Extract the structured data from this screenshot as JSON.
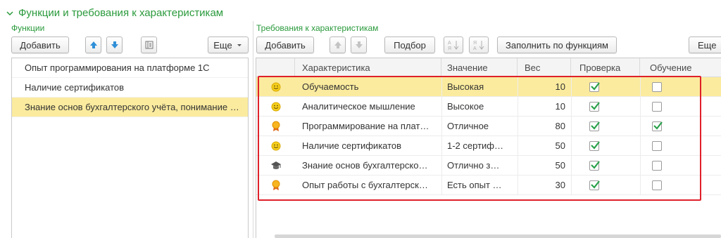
{
  "group": {
    "title": "Функции и требования к характеристикам"
  },
  "left": {
    "label": "Функции",
    "add_label": "Добавить",
    "more_label": "Еще",
    "items": [
      {
        "label": "Опыт программирования на платформе 1С"
      },
      {
        "label": "Наличие сертификатов"
      },
      {
        "label": "Знание основ бухгалтерского учёта, понимание …"
      }
    ]
  },
  "right": {
    "label": "Требования к характеристикам",
    "add_label": "Добавить",
    "select_label": "Подбор",
    "fill_label": "Заполнить по функциям",
    "more_label": "Еще",
    "columns": {
      "characteristic": "Характеристика",
      "value": "Значение",
      "weight": "Вес",
      "check": "Проверка",
      "training": "Обучение"
    },
    "rows": [
      {
        "icon": "smiley-icon",
        "characteristic": "Обучаемость",
        "value": "Высокая",
        "weight": "10",
        "check": true,
        "training": false
      },
      {
        "icon": "smiley-icon",
        "characteristic": "Аналитическое мышление",
        "value": "Высокое",
        "weight": "10",
        "check": true,
        "training": false
      },
      {
        "icon": "award-medal-icon",
        "characteristic": "Программирование на плат…",
        "value": "Отличное",
        "weight": "80",
        "check": true,
        "training": true
      },
      {
        "icon": "smiley-icon",
        "characteristic": "Наличие сертификатов",
        "value": "1-2 сертиф…",
        "weight": "50",
        "check": true,
        "training": false
      },
      {
        "icon": "graduation-cap-icon",
        "characteristic": "Знание основ бухгалтерско…",
        "value": "Отлично з…",
        "weight": "50",
        "check": true,
        "training": false
      },
      {
        "icon": "award-medal-icon",
        "characteristic": "Опыт работы с бухгалтерск…",
        "value": "Есть опыт …",
        "weight": "30",
        "check": true,
        "training": false
      }
    ]
  },
  "colors": {
    "accent_green": "#2a9a3c",
    "selection": "#fbeb9e",
    "highlight_border": "#e0202a",
    "arrow_blue": "#2f8fd8"
  }
}
